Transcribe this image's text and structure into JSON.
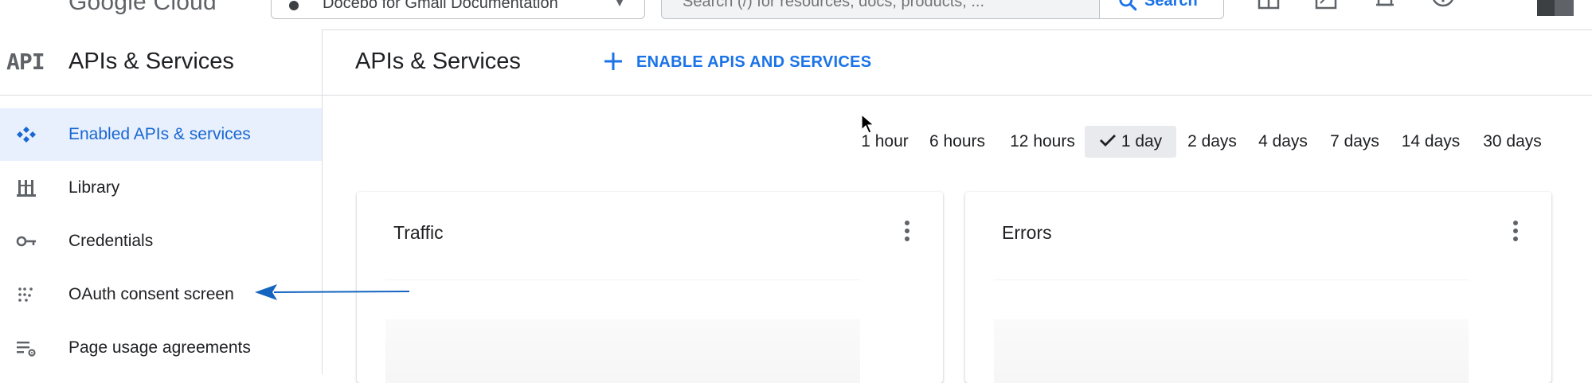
{
  "topbar": {
    "logo_text": "Google Cloud",
    "project_name": "Docebo for Gmail Documentation",
    "search_placeholder": "Search (/) for resources, docs, products, ...",
    "search_button": "Search",
    "icons": [
      "menu-icon",
      "gift-icon",
      "terminal-icon",
      "bell-icon",
      "help-icon",
      "more-vert-icon"
    ]
  },
  "sidebar": {
    "logo": "API",
    "title": "APIs & Services",
    "items": [
      {
        "label": "Enabled APIs & services",
        "icon": "api-diamond-icon",
        "active": true
      },
      {
        "label": "Library",
        "icon": "library-icon",
        "active": false
      },
      {
        "label": "Credentials",
        "icon": "key-icon",
        "active": false
      },
      {
        "label": "OAuth consent screen",
        "icon": "oauth-dots-icon",
        "active": false
      },
      {
        "label": "Page usage agreements",
        "icon": "settings-list-icon",
        "active": false
      }
    ]
  },
  "main": {
    "title": "APIs & Services",
    "enable_button": "ENABLE APIS AND SERVICES",
    "time_ranges": [
      "1 hour",
      "6 hours",
      "12 hours",
      "1 day",
      "2 days",
      "4 days",
      "7 days",
      "14 days",
      "30 days"
    ],
    "selected_time_range": "1 day",
    "cards": [
      {
        "title": "Traffic"
      },
      {
        "title": "Errors"
      }
    ]
  },
  "colors": {
    "accent": "#1a73e8",
    "active_bg": "#e8f0fe",
    "annotation_arrow": "#1565c0"
  }
}
